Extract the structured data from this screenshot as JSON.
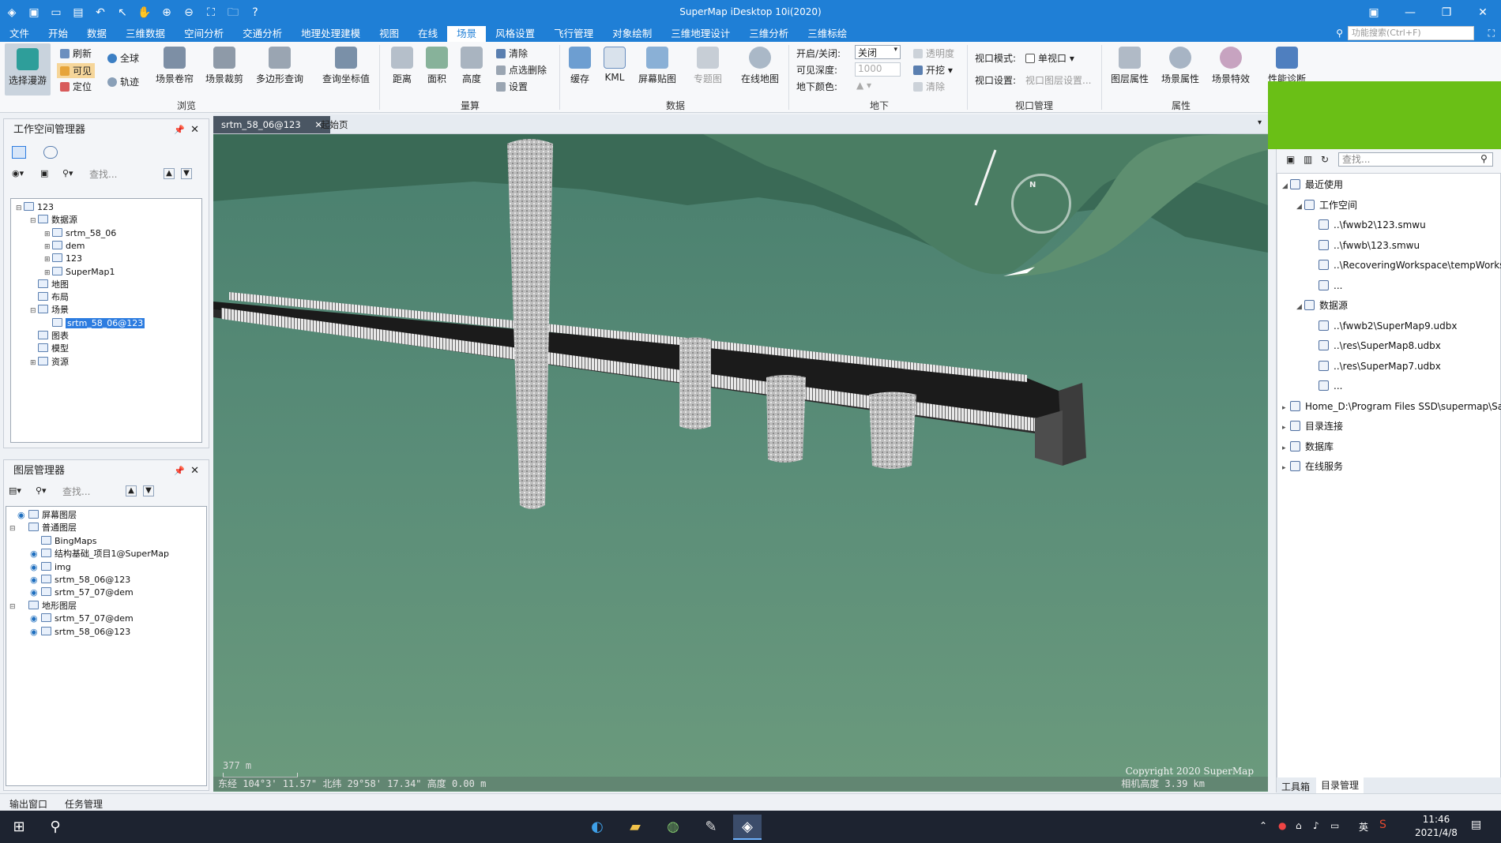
{
  "title": "SuperMap iDesktop 10i(2020)",
  "menus": [
    "文件",
    "开始",
    "数据",
    "三维数据",
    "空间分析",
    "交通分析",
    "地理处理建模",
    "视图",
    "在线",
    "场景",
    "风格设置",
    "飞行管理",
    "对象绘制",
    "三维地理设计",
    "三维分析",
    "三维标绘"
  ],
  "menu_search_placeholder": "功能搜索(Ctrl+F)",
  "ribbon": {
    "browse": {
      "select_roam": "选择漫游",
      "refresh": "刷新",
      "visible": "可见",
      "locate": "定位",
      "globe": "全球",
      "track": "轨迹",
      "scene_roll": "场景卷帘",
      "scene_clip": "场景裁剪",
      "polygon_query": "多边形查询",
      "query_coord": "查询坐标值",
      "group": "浏览"
    },
    "measure": {
      "distance": "距离",
      "area": "面积",
      "height": "高度",
      "clear": "清除",
      "point_delete": "点选删除",
      "settings": "设置",
      "group": "量算"
    },
    "data": {
      "cache": "缓存",
      "kml": "KML",
      "screen_paste": "屏幕贴图",
      "thematic": "专题图",
      "online_map": "在线地图",
      "group": "数据"
    },
    "underground": {
      "toggle_label": "开启/关闭:",
      "toggle_value": "关闭",
      "depth_label": "可见深度:",
      "depth_value": "1000",
      "color_label": "地下颜色:",
      "transparency": "透明度",
      "excavate": "开挖",
      "clear": "清除",
      "group": "地下"
    },
    "viewport": {
      "mode_label": "视口模式:",
      "mode_value": "单视口",
      "settings_label": "视口设置:",
      "settings_value": "视口图层设置...",
      "group": "视口管理"
    },
    "props": {
      "layer_props": "图层属性",
      "scene_props": "场景属性",
      "scene_effects": "场景特效",
      "group": "属性",
      "perf_diag": "性能诊断"
    }
  },
  "workspace": {
    "title": "工作空间管理器",
    "search_placeholder": "查找...",
    "nodes": [
      {
        "label": "123",
        "indent": 0,
        "toggle": "⊟"
      },
      {
        "label": "数据源",
        "indent": 1,
        "toggle": "⊟"
      },
      {
        "label": "srtm_58_06",
        "indent": 2,
        "toggle": "⊞"
      },
      {
        "label": "dem",
        "indent": 2,
        "toggle": "⊞"
      },
      {
        "label": "123",
        "indent": 2,
        "toggle": "⊞"
      },
      {
        "label": "SuperMap1",
        "indent": 2,
        "toggle": "⊞"
      },
      {
        "label": "地图",
        "indent": 1,
        "toggle": ""
      },
      {
        "label": "布局",
        "indent": 1,
        "toggle": ""
      },
      {
        "label": "场景",
        "indent": 1,
        "toggle": "⊟"
      },
      {
        "label": "srtm_58_06@123",
        "indent": 2,
        "toggle": "",
        "selected": true
      },
      {
        "label": "图表",
        "indent": 1,
        "toggle": ""
      },
      {
        "label": "模型",
        "indent": 1,
        "toggle": ""
      },
      {
        "label": "资源",
        "indent": 1,
        "toggle": "⊞"
      }
    ]
  },
  "layers": {
    "title": "图层管理器",
    "search_placeholder": "查找...",
    "nodes": [
      {
        "label": "屏幕图层",
        "indent": 0,
        "toggle": "",
        "eye": true
      },
      {
        "label": "普通图层",
        "indent": 0,
        "toggle": "⊟",
        "eye": false
      },
      {
        "label": "BingMaps",
        "indent": 1,
        "toggle": "",
        "eye": false
      },
      {
        "label": "结构基础_项目1@SuperMap",
        "indent": 1,
        "toggle": "",
        "eye": true
      },
      {
        "label": "img",
        "indent": 1,
        "toggle": "",
        "eye": true
      },
      {
        "label": "srtm_58_06@123",
        "indent": 1,
        "toggle": "",
        "eye": true
      },
      {
        "label": "srtm_57_07@dem",
        "indent": 1,
        "toggle": "",
        "eye": true
      },
      {
        "label": "地形图层",
        "indent": 0,
        "toggle": "⊟",
        "eye": false
      },
      {
        "label": "srtm_57_07@dem",
        "indent": 1,
        "toggle": "",
        "eye": true
      },
      {
        "label": "srtm_58_06@123",
        "indent": 1,
        "toggle": "",
        "eye": true
      }
    ]
  },
  "doc_tabs": [
    "srtm_58_06@123",
    "起始页"
  ],
  "scene": {
    "scale_label": "377 m",
    "copyright": "Copyright 2020 SuperMap",
    "camera_height": "相机高度 3.39 km",
    "status": "东经 104°3' 11.57\"   北纬 29°58' 17.34\"   高度 0.00 m",
    "compass_letter": "N"
  },
  "catalog": {
    "search_placeholder": "查找...",
    "nodes": [
      {
        "label": "最近使用",
        "indent": 0,
        "toggle": "◢"
      },
      {
        "label": "工作空间",
        "indent": 1,
        "toggle": "◢"
      },
      {
        "label": "..\\fwwb2\\123.smwu",
        "indent": 2,
        "toggle": ""
      },
      {
        "label": "..\\fwwb\\123.smwu",
        "indent": 2,
        "toggle": ""
      },
      {
        "label": "..\\RecoveringWorkspace\\tempWorks...",
        "indent": 2,
        "toggle": ""
      },
      {
        "label": "...",
        "indent": 2,
        "toggle": ""
      },
      {
        "label": "数据源",
        "indent": 1,
        "toggle": "◢"
      },
      {
        "label": "..\\fwwb2\\SuperMap9.udbx",
        "indent": 2,
        "toggle": ""
      },
      {
        "label": "..\\res\\SuperMap8.udbx",
        "indent": 2,
        "toggle": ""
      },
      {
        "label": "..\\res\\SuperMap7.udbx",
        "indent": 2,
        "toggle": ""
      },
      {
        "label": "...",
        "indent": 2,
        "toggle": ""
      },
      {
        "label": "Home_D:\\Program Files SSD\\supermap\\Sam...",
        "indent": 0,
        "toggle": "▸"
      },
      {
        "label": "目录连接",
        "indent": 0,
        "toggle": "▸"
      },
      {
        "label": "数据库",
        "indent": 0,
        "toggle": "▸"
      },
      {
        "label": "在线服务",
        "indent": 0,
        "toggle": "▸"
      }
    ],
    "tabs": [
      "工具箱",
      "目录管理"
    ]
  },
  "bottom_tabs": [
    "输出窗口",
    "任务管理"
  ],
  "taskbar": {
    "time": "11:46",
    "date": "2021/4/8",
    "ime": "英"
  },
  "colors": {
    "accent": "#1f7fd6",
    "green_block": "#6abf16",
    "selection": "#2c7ce0"
  }
}
